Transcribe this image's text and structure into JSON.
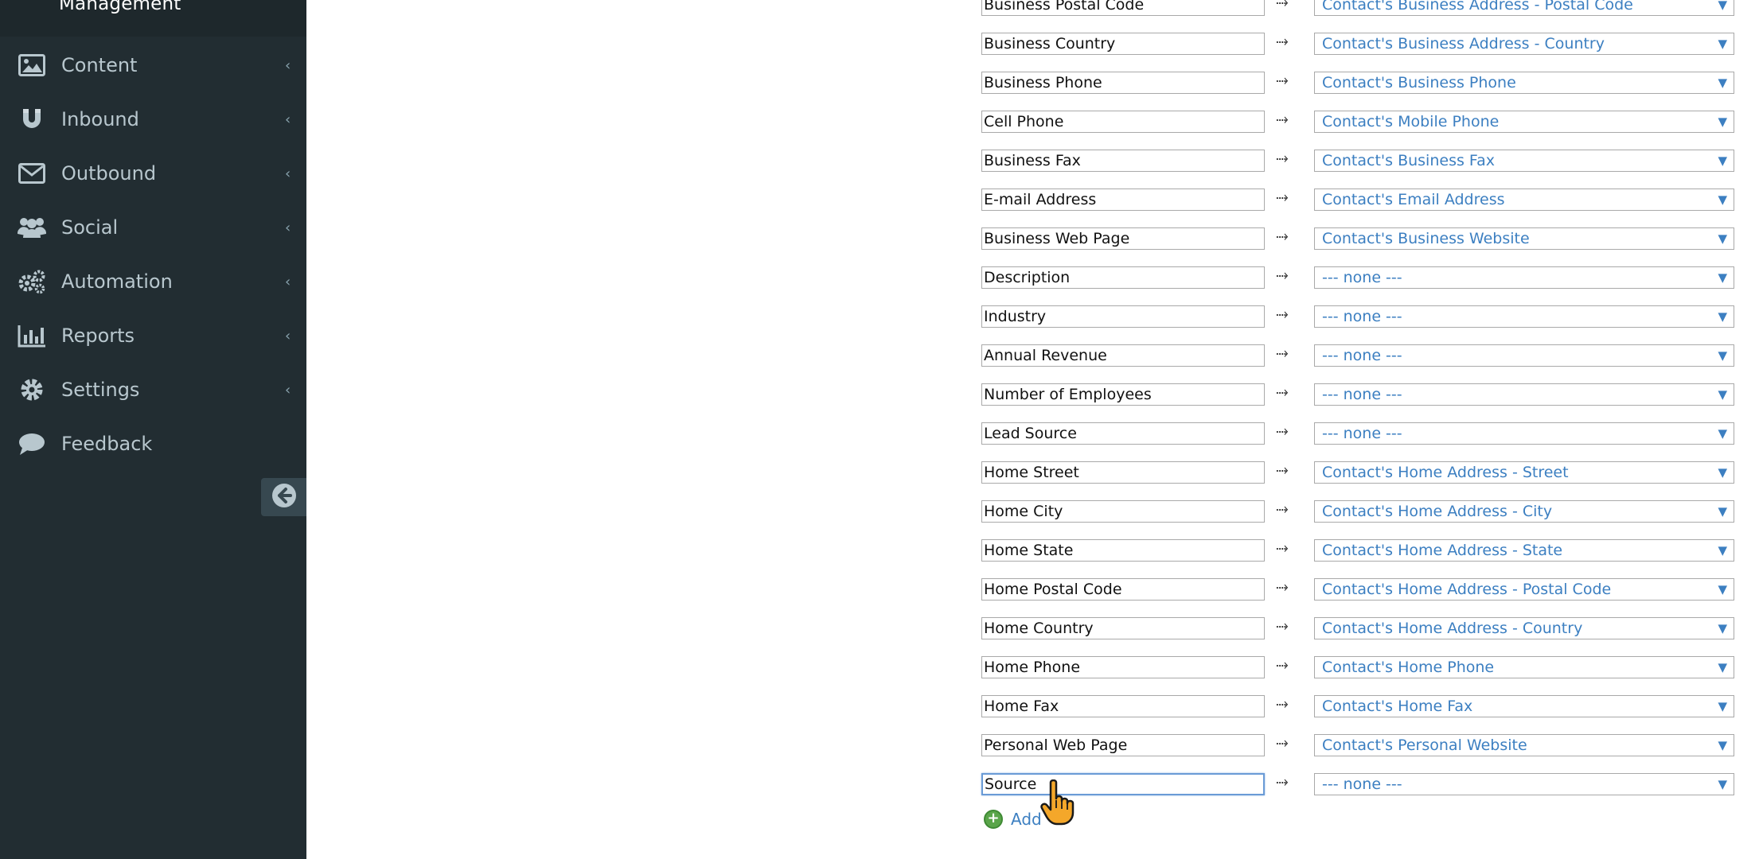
{
  "sidebar": {
    "top_label": "Management",
    "items": [
      {
        "label": "Content",
        "icon": "image-icon"
      },
      {
        "label": "Inbound",
        "icon": "magnet-icon"
      },
      {
        "label": "Outbound",
        "icon": "envelope-icon"
      },
      {
        "label": "Social",
        "icon": "users-icon"
      },
      {
        "label": "Automation",
        "icon": "gears-icon"
      },
      {
        "label": "Reports",
        "icon": "bar-chart-icon"
      },
      {
        "label": "Settings",
        "icon": "gear-icon"
      },
      {
        "label": "Feedback",
        "icon": "comment-icon"
      }
    ],
    "chevron": "‹",
    "collapse_icon": "arrow-left-circle-icon"
  },
  "mapping": {
    "arrow": "⤑",
    "caret": "▼",
    "rows": [
      {
        "field": "Business Postal Code",
        "target": "Contact's Business Address - Postal Code"
      },
      {
        "field": "Business Country",
        "target": "Contact's Business Address - Country"
      },
      {
        "field": "Business Phone",
        "target": "Contact's Business Phone"
      },
      {
        "field": "Cell Phone",
        "target": "Contact's Mobile Phone"
      },
      {
        "field": "Business Fax",
        "target": "Contact's Business Fax"
      },
      {
        "field": "E-mail Address",
        "target": "Contact's Email Address"
      },
      {
        "field": "Business Web Page",
        "target": "Contact's Business Website"
      },
      {
        "field": "Description",
        "target": "--- none ---"
      },
      {
        "field": "Industry",
        "target": "--- none ---"
      },
      {
        "field": "Annual Revenue",
        "target": "--- none ---"
      },
      {
        "field": "Number of Employees",
        "target": "--- none ---"
      },
      {
        "field": "Lead Source",
        "target": "--- none ---"
      },
      {
        "field": "Home Street",
        "target": "Contact's Home Address - Street"
      },
      {
        "field": "Home City",
        "target": "Contact's Home Address - City"
      },
      {
        "field": "Home State",
        "target": "Contact's Home Address - State"
      },
      {
        "field": "Home Postal Code",
        "target": "Contact's Home Address - Postal Code"
      },
      {
        "field": "Home Country",
        "target": "Contact's Home Address - Country"
      },
      {
        "field": "Home Phone",
        "target": "Contact's Home Phone"
      },
      {
        "field": "Home Fax",
        "target": "Contact's Home Fax"
      },
      {
        "field": "Personal Web Page",
        "target": "Contact's Personal Website"
      },
      {
        "field": "Source",
        "target": "--- none ---"
      }
    ],
    "add_label": "Add"
  },
  "colors": {
    "sidebar_bg": "#222d32",
    "link_blue": "#3c7fc1",
    "add_green": "#5aa54a"
  }
}
